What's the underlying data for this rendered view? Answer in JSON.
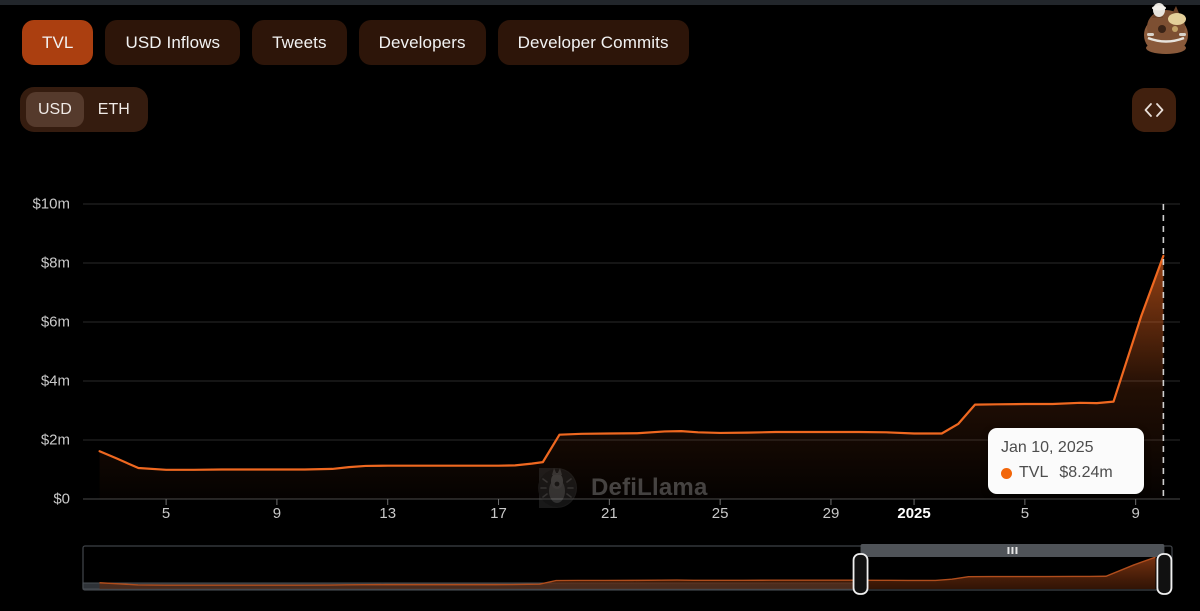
{
  "header": {
    "tabs": [
      {
        "label": "TVL",
        "active": true
      },
      {
        "label": "USD Inflows",
        "active": false
      },
      {
        "label": "Tweets",
        "active": false
      },
      {
        "label": "Developers",
        "active": false
      },
      {
        "label": "Developer Commits",
        "active": false
      }
    ],
    "currency": {
      "options": [
        {
          "label": "USD",
          "active": true
        },
        {
          "label": "ETH",
          "active": false
        }
      ]
    },
    "embed_button": {
      "icon": "code-embed-icon",
      "label": "<>"
    },
    "mascot": {
      "icon": "defillama-llama-mascot-icon"
    }
  },
  "watermark": {
    "text": "DefiLlama",
    "icon": "defillama-logo-icon"
  },
  "tooltip": {
    "date": "Jan 10, 2025",
    "series_name": "TVL",
    "value": "$8.24m",
    "dot_color": "#f2660a"
  },
  "colors": {
    "accent": "#f2660a",
    "line": "#ef6820",
    "tab_active": "#ab3f10",
    "tab_inactive": "#2d1509",
    "background": "#000000",
    "grid": "#2a2a2a"
  },
  "chart_data": {
    "type": "area",
    "title": "",
    "xlabel": "",
    "ylabel": "",
    "ylim": [
      0,
      10
    ],
    "y_unit": "m",
    "grid": true,
    "legend_position": "none",
    "ytick_labels": [
      "$0",
      "$2m",
      "$4m",
      "$6m",
      "$8m",
      "$10m"
    ],
    "ytick_values": [
      0,
      2,
      4,
      6,
      8,
      10
    ],
    "xtick_labels": [
      "5",
      "9",
      "13",
      "17",
      "21",
      "25",
      "29",
      "2025",
      "5",
      "9"
    ],
    "xtick_bold": [
      "2025"
    ],
    "xtick_days": [
      5,
      9,
      13,
      17,
      21,
      25,
      29,
      32,
      36,
      40
    ],
    "highlight_marker": {
      "x_day": 41,
      "label": "Jan 10, 2025",
      "value": 8.24,
      "style": "dashed-vertical"
    },
    "series": [
      {
        "name": "TVL",
        "color": "#ef6820",
        "x": [
          2.6,
          3.2,
          4.0,
          5.0,
          6.0,
          7.0,
          8.0,
          9.0,
          10.0,
          11.0,
          11.6,
          12.2,
          13.0,
          14.0,
          15.0,
          16.0,
          17.0,
          17.6,
          18.2,
          18.6,
          19.2,
          20.0,
          21.0,
          22.0,
          23.0,
          23.6,
          24.2,
          25.0,
          26.0,
          27.0,
          28.0,
          29.0,
          30.0,
          31.0,
          32.0,
          33.0,
          33.6,
          34.2,
          35.0,
          36.0,
          37.0,
          38.0,
          38.6,
          39.2,
          40.2,
          41.0
        ],
        "values": [
          1.62,
          1.38,
          1.05,
          0.99,
          0.99,
          1.0,
          1.0,
          1.0,
          1.0,
          1.02,
          1.08,
          1.12,
          1.13,
          1.13,
          1.13,
          1.13,
          1.13,
          1.14,
          1.2,
          1.25,
          2.18,
          2.21,
          2.22,
          2.23,
          2.29,
          2.3,
          2.26,
          2.24,
          2.25,
          2.27,
          2.27,
          2.27,
          2.27,
          2.26,
          2.22,
          2.22,
          2.55,
          3.2,
          3.21,
          3.22,
          3.22,
          3.26,
          3.25,
          3.3,
          6.2,
          8.24
        ]
      }
    ]
  },
  "brush": {
    "selection": {
      "start_pct": 71.4,
      "end_pct": 99.3
    },
    "handle_left": "brush-handle-left",
    "handle_right": "brush-handle-right",
    "drag_bar": "brush-drag-bar"
  }
}
